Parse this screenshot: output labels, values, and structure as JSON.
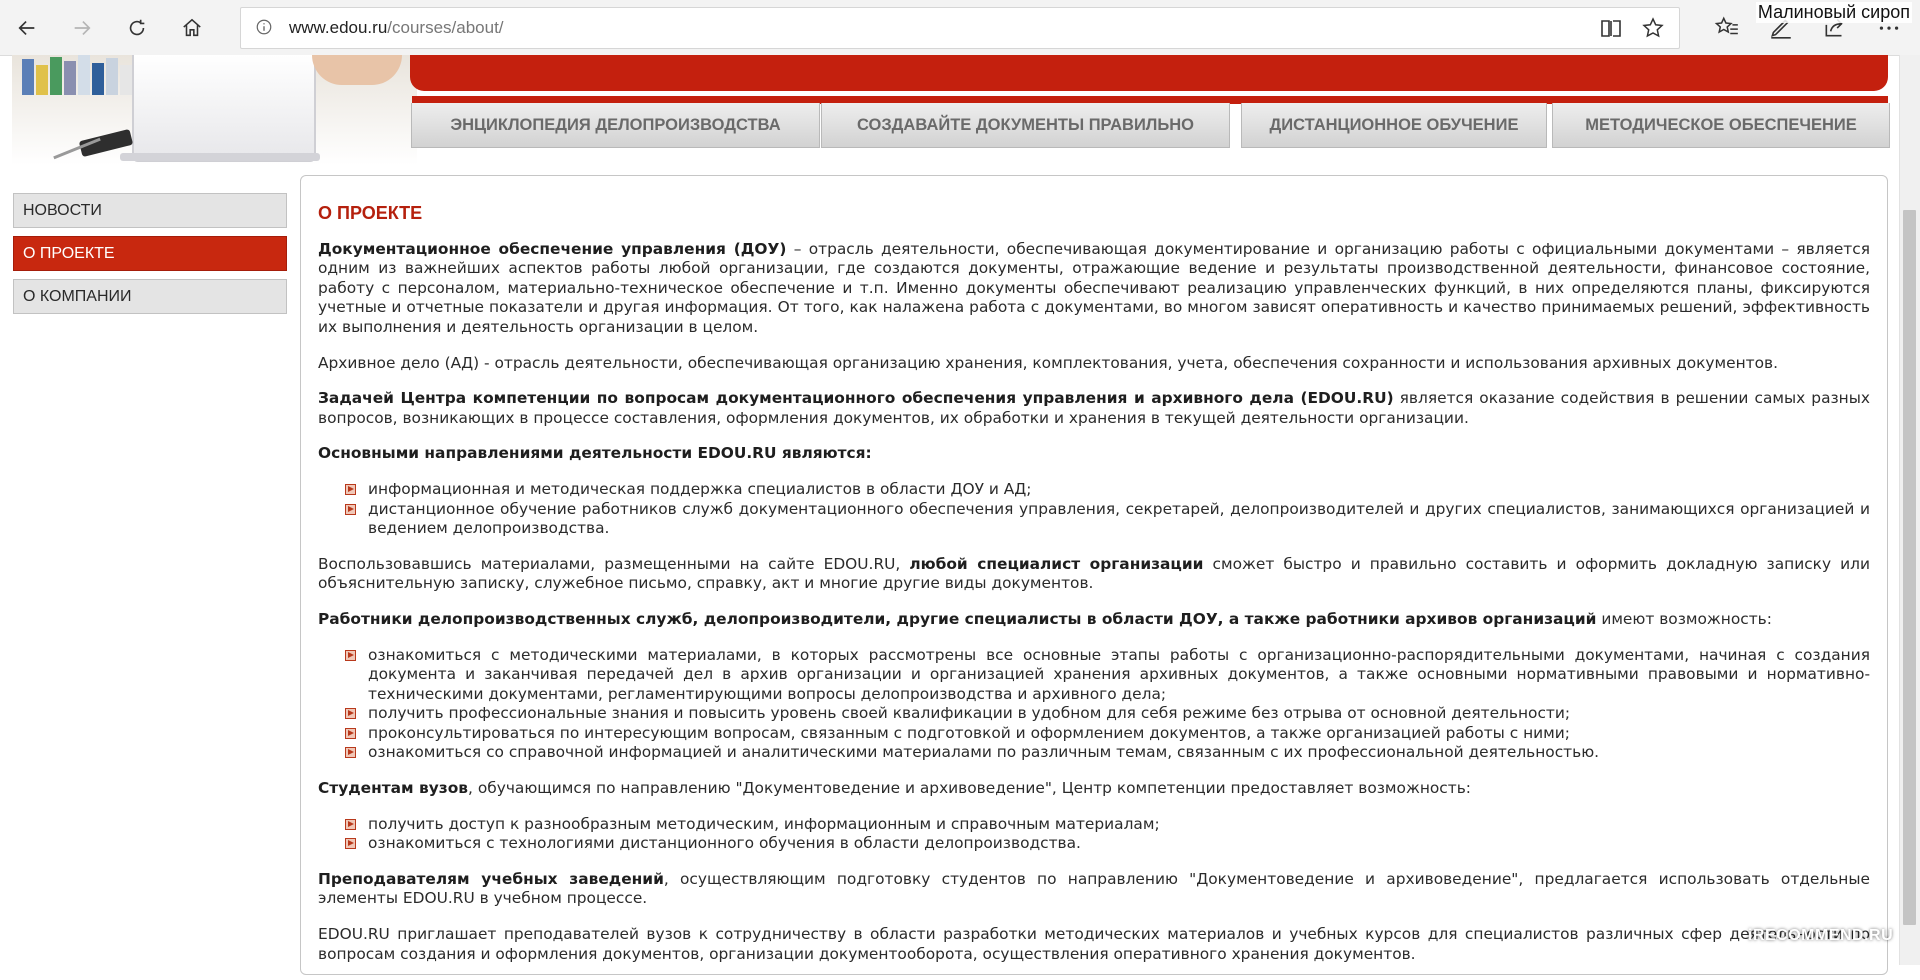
{
  "browser": {
    "url_host": "www.edou.ru",
    "url_path": "/courses/about/",
    "profile_label": "Малиновый сироп",
    "icons": {
      "back": "back-arrow-icon",
      "forward": "forward-arrow-icon",
      "refresh": "refresh-icon",
      "home": "home-icon",
      "info": "info-icon",
      "reading": "reading-view-icon",
      "favorite": "star-icon",
      "favorites_list": "favorites-icon",
      "notes": "pen-icon",
      "share": "share-icon",
      "more": "more-icon"
    }
  },
  "site": {
    "accent_color": "#c4200e",
    "topnav": [
      {
        "label": "ЭНЦИКЛОПЕДИЯ ДЕЛОПРОИЗВОДСТВА"
      },
      {
        "label": "СОЗДАВАЙТЕ ДОКУМЕНТЫ ПРАВИЛЬНО"
      },
      {
        "label": "ДИСТАНЦИОННОЕ ОБУЧЕНИЕ"
      },
      {
        "label": "МЕТОДИЧЕСКОЕ ОБЕСПЕЧЕНИЕ"
      }
    ],
    "sidemenu": [
      {
        "label": "НОВОСТИ",
        "active": false
      },
      {
        "label": "О ПРОЕКТЕ",
        "active": true
      },
      {
        "label": "О КОМПАНИИ",
        "active": false
      }
    ]
  },
  "content": {
    "title": "О ПРОЕКТЕ",
    "p1_bold": "Документационное обеспечение управления (ДОУ)",
    "p1_text": " – отрасль деятельности, обеспечивающая документирование и организацию работы с официальными документами – является одним из важнейших аспектов работы любой организации, где создаются документы, отражающие ведение и результаты производственной деятельности, финансовое состояние, работу с персоналом, материально-техническое обеспечение и т.п. Именно документы обеспечивают реализацию управленческих функций, в них определяются планы, фиксируются учетные и отчетные показатели и другая информация. От того, как налажена работа с документами, во многом зависят оперативность и качество принимаемых решений, эффективность их выполнения и деятельность организации в целом.",
    "p2_text": "Архивное дело (АД) - отрасль деятельности, обеспечивающая организацию хранения, комплектования, учета, обеспечения сохранности и использования архивных документов.",
    "p3_bold": "Задачей Центра компетенции по вопросам документационного обеспечения управления и архивного дела (EDOU.RU)",
    "p3_text": " является оказание содействия в решении самых разных вопросов, возникающих в процессе составления, оформления документов, их обработки и хранения в текущей деятельности организации.",
    "p4_bold": "Основными направлениями деятельности EDOU.RU являются:",
    "list1": [
      "информационная и методическая поддержка специалистов в области ДОУ и АД;",
      "дистанционное обучение работников служб документационного обеспечения управления, секретарей, делопроизводителей и других специалистов, занимающихся организацией и ведением делопроизводства."
    ],
    "p5_pre": "Воспользовавшись материалами, размещенными на сайте EDOU.RU, ",
    "p5_bold": "любой специалист организации",
    "p5_post": " сможет быстро и правильно составить и оформить докладную записку или объяснительную записку, служебное письмо, справку, акт и многие другие виды документов.",
    "p6_bold": "Работники делопроизводственных служб, делопроизводители, другие специалисты в области ДОУ, а также работники архивов организаций",
    "p6_text": " имеют возможность:",
    "list2": [
      "ознакомиться с методическими материалами, в которых рассмотрены все основные этапы работы с организационно-распорядительными документами, начиная с создания документа и заканчивая передачей дел в архив организации и организацией хранения архивных документов, а также основными нормативными правовыми и нормативно-техническими документами, регламентирующими вопросы делопроизводства и архивного дела;",
      "получить профессиональные знания и повысить уровень своей квалификации в удобном для себя режиме без отрыва от основной деятельности;",
      "проконсультироваться по интересующим вопросам, связанным с подготовкой и оформлением документов, а также организацией работы с ними;",
      "ознакомиться со справочной информацией и аналитическими материалами по различным темам, связанным с их профессиональной деятельностью."
    ],
    "p7_bold": "Студентам вузов",
    "p7_text": ", обучающимся по направлению \"Документоведение и архивоведение\", Центр компетенции предоставляет возможность:",
    "list3": [
      "получить доступ к разнообразным методическим, информационным и справочным материалам;",
      "ознакомиться с технологиями дистанционного обучения в области делопроизводства."
    ],
    "p8_bold": "Преподавателям учебных заведений",
    "p8_text": ", осуществляющим подготовку студентов по направлению \"Документоведение и архивоведение\", предлагается использовать отдельные элементы EDOU.RU в учебном процессе.",
    "p9_text": "EDOU.RU приглашает преподавателей вузов к сотрудничеству в области разработки методических материалов и учебных курсов для специалистов различных сфер деятельности по вопросам создания и оформления документов, организации документооборота, осуществления оперативного хранения документов."
  },
  "watermark": "iRECOMMEND.RU"
}
